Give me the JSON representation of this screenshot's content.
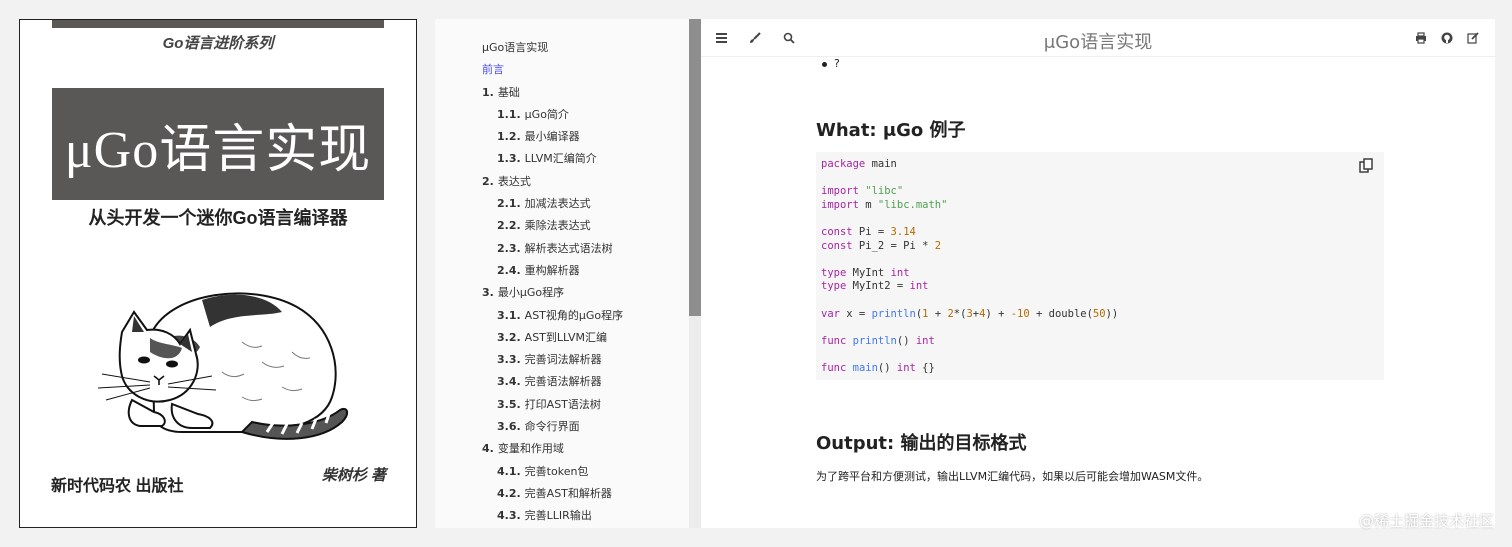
{
  "cover": {
    "series": "Go语言进阶系列",
    "title": "μGo语言实现",
    "subtitle": "从头开发一个迷你Go语言编译器",
    "publisher": "新时代码农 出版社",
    "author": "柴树杉 著"
  },
  "sidebar": {
    "items": [
      {
        "num": "",
        "label": "μGo语言实现",
        "level": 1,
        "active": false
      },
      {
        "num": "",
        "label": "前言",
        "level": 1,
        "active": true
      },
      {
        "num": "1.",
        "label": "基础",
        "level": 1,
        "active": false
      },
      {
        "num": "1.1.",
        "label": "μGo简介",
        "level": 2,
        "active": false
      },
      {
        "num": "1.2.",
        "label": "最小编译器",
        "level": 2,
        "active": false
      },
      {
        "num": "1.3.",
        "label": "LLVM汇编简介",
        "level": 2,
        "active": false
      },
      {
        "num": "2.",
        "label": "表达式",
        "level": 1,
        "active": false
      },
      {
        "num": "2.1.",
        "label": "加减法表达式",
        "level": 2,
        "active": false
      },
      {
        "num": "2.2.",
        "label": "乘除法表达式",
        "level": 2,
        "active": false
      },
      {
        "num": "2.3.",
        "label": "解析表达式语法树",
        "level": 2,
        "active": false
      },
      {
        "num": "2.4.",
        "label": "重构解析器",
        "level": 2,
        "active": false
      },
      {
        "num": "3.",
        "label": "最小μGo程序",
        "level": 1,
        "active": false
      },
      {
        "num": "3.1.",
        "label": "AST视角的μGo程序",
        "level": 2,
        "active": false
      },
      {
        "num": "3.2.",
        "label": "AST到LLVM汇编",
        "level": 2,
        "active": false
      },
      {
        "num": "3.3.",
        "label": "完善词法解析器",
        "level": 2,
        "active": false
      },
      {
        "num": "3.4.",
        "label": "完善语法解析器",
        "level": 2,
        "active": false
      },
      {
        "num": "3.5.",
        "label": "打印AST语法树",
        "level": 2,
        "active": false
      },
      {
        "num": "3.6.",
        "label": "命令行界面",
        "level": 2,
        "active": false
      },
      {
        "num": "4.",
        "label": "变量和作用域",
        "level": 1,
        "active": false
      },
      {
        "num": "4.1.",
        "label": "完善token包",
        "level": 2,
        "active": false
      },
      {
        "num": "4.2.",
        "label": "完善AST和解析器",
        "level": 2,
        "active": false
      },
      {
        "num": "4.3.",
        "label": "完善LLIR输出",
        "level": 2,
        "active": false
      }
    ]
  },
  "topbar": {
    "title": "μGo语言实现",
    "icons_left": [
      "menu-icon",
      "brush-icon",
      "search-icon"
    ],
    "icons_right": [
      "print-icon",
      "github-icon",
      "edit-icon"
    ]
  },
  "content": {
    "bullet": "?",
    "heading_what": "What: μGo 例子",
    "heading_output": "Output: 输出的目标格式",
    "paragraph": "为了跨平台和方便测试，输出LLVM汇编代码，如果以后可能会增加WASM文件。",
    "code": [
      [
        {
          "t": "package",
          "c": "kw"
        },
        {
          "t": " main",
          "c": ""
        }
      ],
      [],
      [
        {
          "t": "import",
          "c": "kw"
        },
        {
          "t": " ",
          "c": ""
        },
        {
          "t": "\"libc\"",
          "c": "str"
        }
      ],
      [
        {
          "t": "import",
          "c": "kw"
        },
        {
          "t": " m ",
          "c": ""
        },
        {
          "t": "\"libc.math\"",
          "c": "str"
        }
      ],
      [],
      [
        {
          "t": "const",
          "c": "kw"
        },
        {
          "t": " Pi = ",
          "c": ""
        },
        {
          "t": "3.14",
          "c": "num"
        }
      ],
      [
        {
          "t": "const",
          "c": "kw"
        },
        {
          "t": " Pi_2 = Pi * ",
          "c": ""
        },
        {
          "t": "2",
          "c": "num"
        }
      ],
      [],
      [
        {
          "t": "type",
          "c": "kw"
        },
        {
          "t": " MyInt ",
          "c": ""
        },
        {
          "t": "int",
          "c": "kw"
        }
      ],
      [
        {
          "t": "type",
          "c": "kw"
        },
        {
          "t": " MyInt2 = ",
          "c": ""
        },
        {
          "t": "int",
          "c": "kw"
        }
      ],
      [],
      [
        {
          "t": "var",
          "c": "kw"
        },
        {
          "t": " x = ",
          "c": ""
        },
        {
          "t": "println",
          "c": "fn"
        },
        {
          "t": "(",
          "c": ""
        },
        {
          "t": "1",
          "c": "num"
        },
        {
          "t": " + ",
          "c": ""
        },
        {
          "t": "2",
          "c": "num"
        },
        {
          "t": "*(",
          "c": ""
        },
        {
          "t": "3",
          "c": "num"
        },
        {
          "t": "+",
          "c": ""
        },
        {
          "t": "4",
          "c": "num"
        },
        {
          "t": ") + ",
          "c": ""
        },
        {
          "t": "-10",
          "c": "num"
        },
        {
          "t": " + double(",
          "c": ""
        },
        {
          "t": "50",
          "c": "num"
        },
        {
          "t": "))",
          "c": ""
        }
      ],
      [],
      [
        {
          "t": "func",
          "c": "kw"
        },
        {
          "t": " ",
          "c": ""
        },
        {
          "t": "println",
          "c": "fn"
        },
        {
          "t": "() ",
          "c": ""
        },
        {
          "t": "int",
          "c": "kw"
        }
      ],
      [],
      [
        {
          "t": "func",
          "c": "kw"
        },
        {
          "t": " ",
          "c": ""
        },
        {
          "t": "main",
          "c": "fn"
        },
        {
          "t": "() ",
          "c": ""
        },
        {
          "t": "int",
          "c": "kw"
        },
        {
          "t": " {}",
          "c": ""
        }
      ]
    ]
  },
  "watermark": "@稀土掘金技术社区"
}
